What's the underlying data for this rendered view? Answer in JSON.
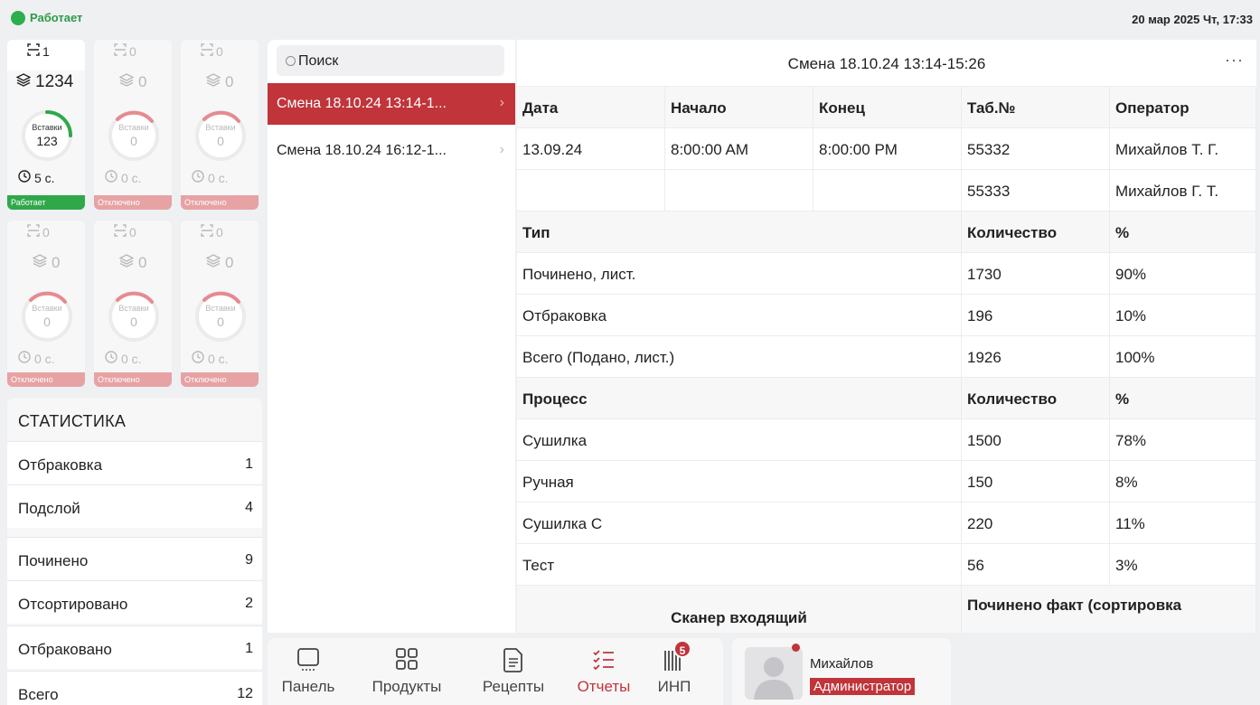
{
  "status": {
    "label": "Работает",
    "color": "#2fae4e"
  },
  "datetime": "20 мар 2025 Чт, 17:33",
  "machines": [
    {
      "scan": "1",
      "count": "1234",
      "gauge_label": "Вставки",
      "gauge_value": "123",
      "time": "5 с.",
      "state": "Работает",
      "active": true
    },
    {
      "scan": "0",
      "count": "0",
      "gauge_label": "Вставки",
      "gauge_value": "0",
      "time": "0 с.",
      "state": "Отключено",
      "active": false
    },
    {
      "scan": "0",
      "count": "0",
      "gauge_label": "Вставки",
      "gauge_value": "0",
      "time": "0 с.",
      "state": "Отключено",
      "active": false
    },
    {
      "scan": "0",
      "count": "0",
      "gauge_label": "Вставки",
      "gauge_value": "0",
      "time": "0 с.",
      "state": "Отключено",
      "active": false
    },
    {
      "scan": "0",
      "count": "0",
      "gauge_label": "Вставки",
      "gauge_value": "0",
      "time": "0 с.",
      "state": "Отключено",
      "active": false
    },
    {
      "scan": "0",
      "count": "0",
      "gauge_label": "Вставки",
      "gauge_value": "0",
      "time": "0 с.",
      "state": "Отключено",
      "active": false
    }
  ],
  "stats": {
    "title": "СТАТИСТИКА",
    "rows": [
      {
        "label": "Отбраковка",
        "value": "1"
      },
      {
        "label": "Подслой",
        "value": "4"
      },
      {
        "label": "Починено",
        "value": "9"
      },
      {
        "label": "Отсортировано",
        "value": "2"
      },
      {
        "label": "Отбраковано",
        "value": "1"
      },
      {
        "label": "Всего",
        "value": "12"
      }
    ]
  },
  "search": {
    "placeholder": "Поиск"
  },
  "shifts": [
    {
      "label": "Смена 18.10.24 13:14-1...",
      "selected": true
    },
    {
      "label": "Смена 18.10.24 16:12-1...",
      "selected": false
    }
  ],
  "report": {
    "title": "Смена 18.10.24 13:14-15:26",
    "more": "···",
    "header": {
      "date": "Дата",
      "start": "Начало",
      "end": "Конец",
      "tab": "Таб.№",
      "operator": "Оператор"
    },
    "row1": {
      "date": "13.09.24",
      "start": "8:00:00 AM",
      "end": "8:00:00 PM",
      "tab": "55332",
      "operator": "Михайлов Т. Г."
    },
    "row2": {
      "tab": "55333",
      "operator": "Михайлов Г. Т."
    },
    "type_section": {
      "header": {
        "name": "Тип",
        "qty": "Количество",
        "pct": "%"
      },
      "rows": [
        {
          "name": "Починено, лист.",
          "qty": "1730",
          "pct": "90%"
        },
        {
          "name": "Отбраковка",
          "qty": "196",
          "pct": "10%"
        },
        {
          "name": "Всего (Подано, лист.)",
          "qty": "1926",
          "pct": "100%"
        }
      ]
    },
    "process_section": {
      "header": {
        "name": "Процесс",
        "qty": "Количество",
        "pct": "%"
      },
      "rows": [
        {
          "name": "Сушилка",
          "qty": "1500",
          "pct": "78%"
        },
        {
          "name": "Ручная",
          "qty": "150",
          "pct": "8%"
        },
        {
          "name": "Сушилка С",
          "qty": "220",
          "pct": "11%"
        },
        {
          "name": "Тест",
          "qty": "56",
          "pct": "3%"
        }
      ]
    },
    "footer": {
      "left": "Сканер входящий",
      "right": "Починено факт (сортировка"
    }
  },
  "nav": [
    {
      "label": "Панель",
      "icon": "panel-icon",
      "active": false
    },
    {
      "label": "Продукты",
      "icon": "grid-icon",
      "active": false
    },
    {
      "label": "Рецепты",
      "icon": "document-icon",
      "active": false
    },
    {
      "label": "Отчеты",
      "icon": "checklist-icon",
      "active": true
    },
    {
      "label": "ИНП",
      "icon": "barcode-icon",
      "active": false,
      "badge": "5"
    }
  ],
  "user": {
    "name": "Михайлов",
    "role": "Администратор"
  },
  "colors": {
    "accent": "#c0343a",
    "ok": "#30a84a",
    "off": "#e7a2a4"
  }
}
